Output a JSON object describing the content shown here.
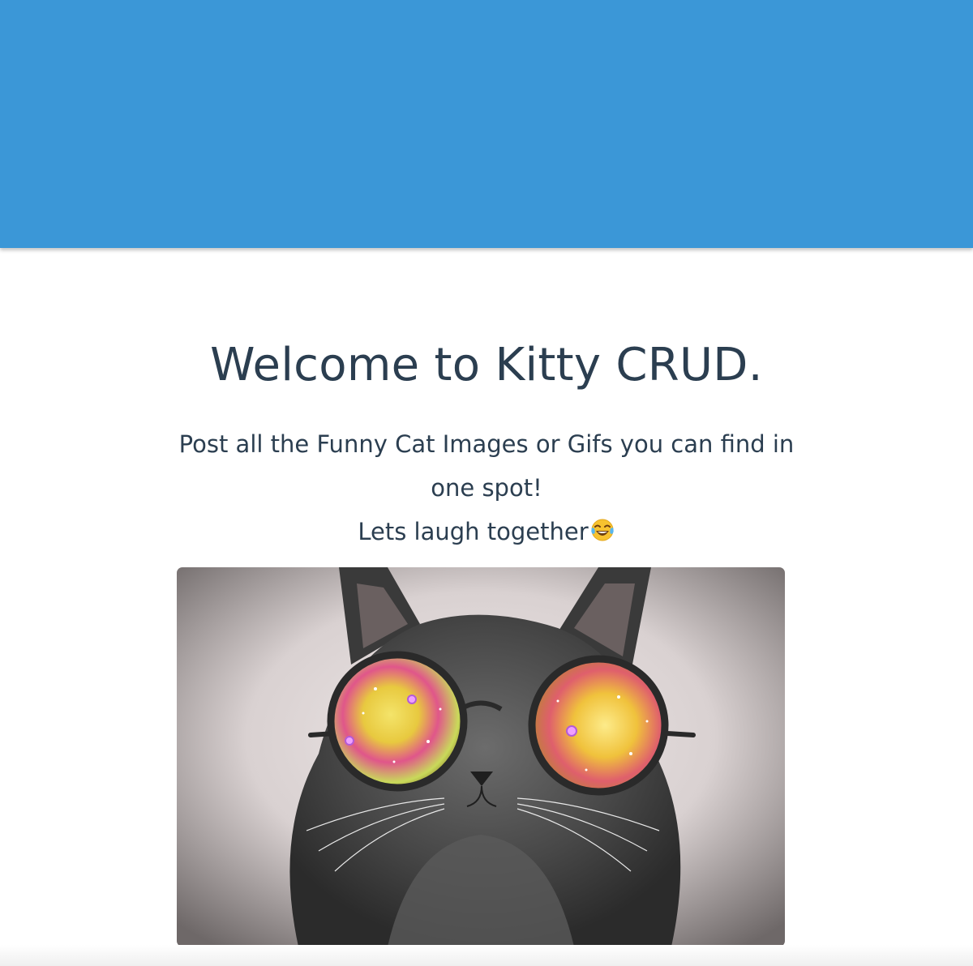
{
  "header": {
    "color": "#3b97d7"
  },
  "hero": {
    "title": "Welcome to Kitty CRUD.",
    "subtitle": "Post all the Funny Cat Images or Gifs you can find in one spot!",
    "tagline": "Lets laugh together",
    "tagline_icon": "tears-of-joy-emoji-icon",
    "text_color": "#2b3e50"
  },
  "featured_image": {
    "subject": "grey cat wearing round glasses with colorful galaxy lenses"
  }
}
